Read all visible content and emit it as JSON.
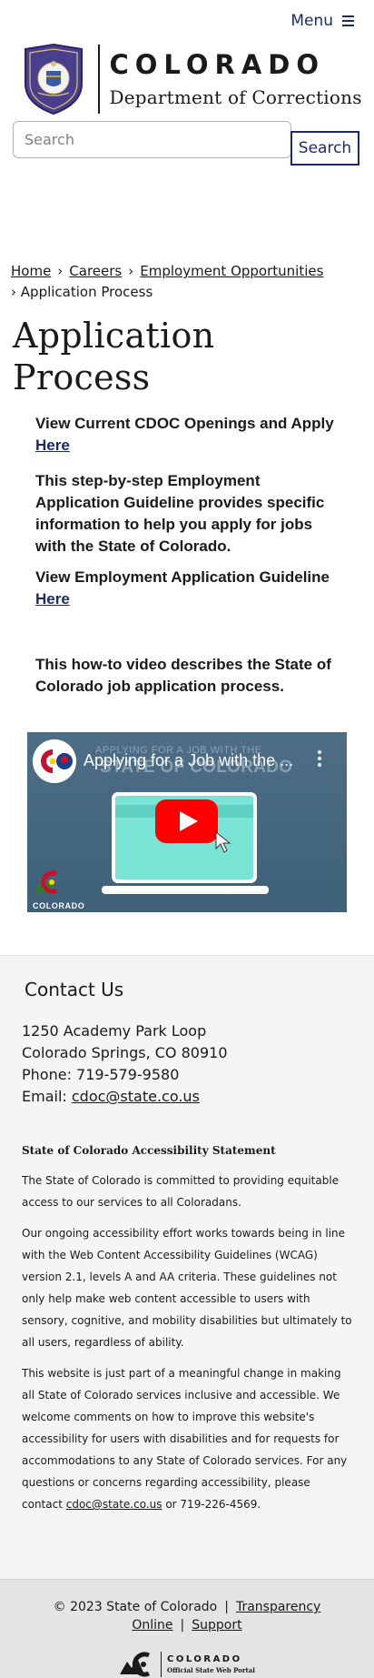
{
  "header": {
    "menu_label": "Menu",
    "brand_state": "COLORADO",
    "brand_dept": "Department of Corrections"
  },
  "search": {
    "placeholder": "Search",
    "button_label": "Search"
  },
  "breadcrumb": [
    {
      "label": "Home"
    },
    {
      "label": "Careers"
    },
    {
      "label": "Employment Opportunities"
    },
    {
      "label": "Application Process"
    }
  ],
  "page_title": "Application Process",
  "content": {
    "openings_text": "View Current CDOC Openings and Apply",
    "openings_link": "Here",
    "guideline_desc": "This step-by-step Employment Application Guideline provides specific information to help you apply for jobs with the State of Colorado.",
    "guideline_text": "View Employment Application Guideline",
    "guideline_link": "Here",
    "video_intro": " This how-to video describes the State of Colorado job application process."
  },
  "video": {
    "title": "Applying for a Job with the ...",
    "bg_line1": "APPLYING FOR A JOB WITH THE",
    "bg_line2": "STATE OF COLORADO",
    "logo_label": "COLORADO",
    "play_color": "#ff0000",
    "bg_color": "#4d6e86"
  },
  "contact": {
    "heading": "Contact Us",
    "address_line1": "1250 Academy Park Loop",
    "address_line2": "Colorado Springs, CO 80910",
    "phone": "Phone: 719-579-9580",
    "email_label": "Email: ",
    "email": "cdoc@state.co.us"
  },
  "accessibility": {
    "title": "State of Colorado Accessibility Statement",
    "p1": "The State of Colorado is committed to providing equitable access to our services to all Coloradans.",
    "p2": "Our ongoing accessibility effort works towards being in line with the Web Content Accessibility Guidelines (WCAG) version 2.1, levels A and AA criteria. These guidelines not only help make web content accessible to users with sensory, cognitive, and mobility disabilities but ultimately to all users, regardless of ability.",
    "p3_text": "This website is just part of a meaningful change in making all State of Colorado services inclusive and accessible. We welcome comments on how to improve this website's accessibility for users with disabilities and for requests for accommodations to any State of Colorado services. For any questions or concerns regarding accessibility, please contact ",
    "p3_email": "cdoc@state.co.us",
    "p3_tail": " or 719-226-4569."
  },
  "footer": {
    "copyright": "© 2023 State of Colorado",
    "separator": "|",
    "transparency_link": "Transparency Online",
    "support_link": "Support",
    "logo_line1": "COLORADO",
    "logo_line2": "Official State Web Portal"
  },
  "colors": {
    "accent_navy": "#1b2a6b",
    "contact_bg": "#f5f5f5",
    "footer_bg": "#e4e4e4"
  }
}
